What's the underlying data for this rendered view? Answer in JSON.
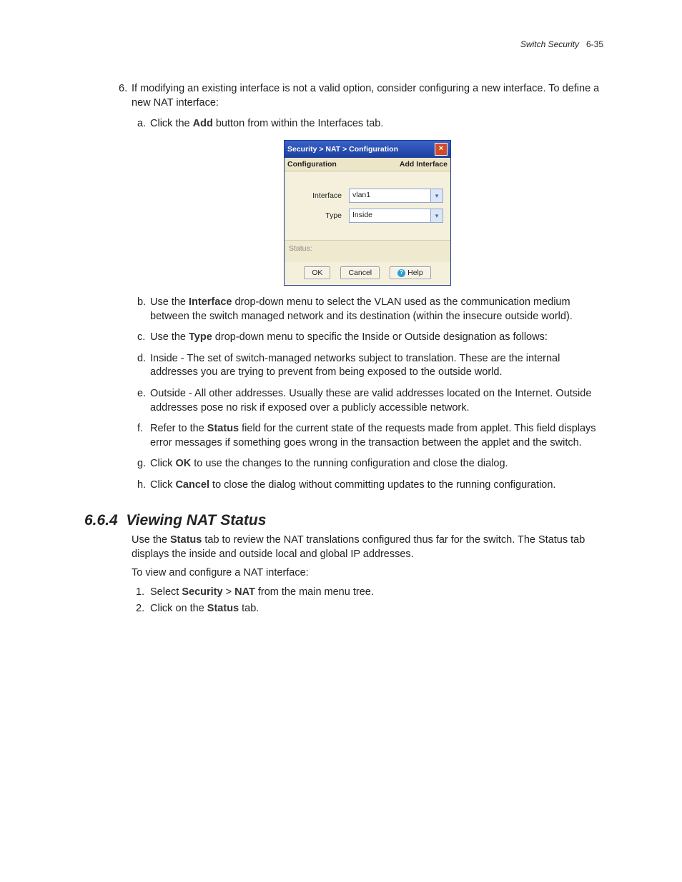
{
  "header": {
    "chapter": "Switch Security",
    "pageNum": "6-35"
  },
  "step6": {
    "num": "6.",
    "text": "If modifying an existing interface is not a valid option, consider configuring a new interface. To define a new NAT interface:"
  },
  "subA": {
    "letter": "a.",
    "pre": "Click the ",
    "bold": "Add",
    "post": " button from within the Interfaces tab."
  },
  "dialog": {
    "title": "Security > NAT > Configuration",
    "subLeft": "Configuration",
    "subRight": "Add Interface",
    "rowIfaceLabel": "Interface",
    "rowIfaceValue": "vlan1",
    "rowTypeLabel": "Type",
    "rowTypeValue": "Inside",
    "status": "Status:",
    "btnOk": "OK",
    "btnCancel": "Cancel",
    "btnHelp": "Help"
  },
  "subB": {
    "letter": "b.",
    "pre": "Use the ",
    "bold": "Interface",
    "post": " drop-down menu to select the VLAN used as the communication medium between the switch managed network and its destination (within the insecure outside world)."
  },
  "subC": {
    "letter": "c.",
    "pre": "Use the ",
    "bold": "Type",
    "post": " drop-down menu to specific the Inside or Outside designation as follows:"
  },
  "subD": {
    "letter": "d.",
    "text": "Inside - The set of switch-managed networks subject to translation. These are the internal addresses you are trying to prevent from being exposed to the outside world."
  },
  "subE": {
    "letter": "e.",
    "text": "Outside - All other addresses. Usually these are valid addresses located on the Internet. Outside addresses pose no risk if exposed over a publicly accessible network."
  },
  "subF": {
    "letter": "f.",
    "pre": "Refer to the ",
    "bold": "Status",
    "post": " field for the current state of the requests made from applet. This field displays error messages if something goes wrong in the transaction between the applet and the switch."
  },
  "subG": {
    "letter": "g.",
    "pre": "Click ",
    "bold": "OK",
    "post": " to use the changes to the running configuration and close the dialog."
  },
  "subH": {
    "letter": "h.",
    "pre": "Click ",
    "bold": "Cancel",
    "post": " to close the dialog without committing updates to the running configuration."
  },
  "section": {
    "num": "6.6.4",
    "title": "Viewing NAT Status"
  },
  "intro1": {
    "pre": "Use the ",
    "bold": "Status",
    "post": " tab to review the NAT translations configured thus far for the switch. The Status tab displays the inside and outside local and global IP addresses."
  },
  "intro2": "To view and configure a NAT interface:",
  "step1": {
    "n": "1.",
    "pre": "Select ",
    "b1": "Security",
    "mid": " > ",
    "b2": "NAT",
    "post": " from the main menu tree."
  },
  "step2": {
    "n": "2.",
    "pre": "Click on the ",
    "bold": "Status",
    "post": " tab."
  }
}
